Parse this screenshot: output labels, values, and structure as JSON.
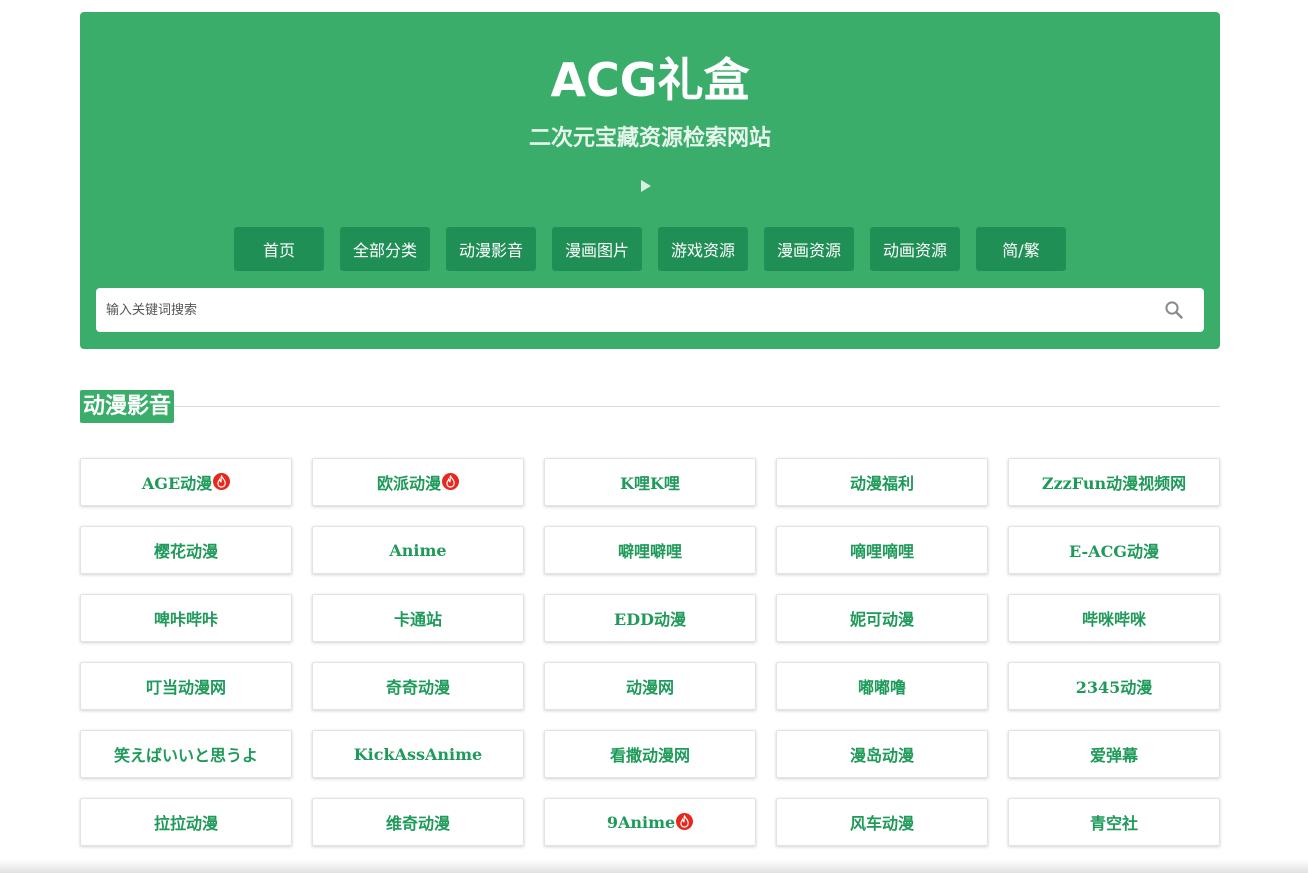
{
  "site": {
    "title": "ACG礼盒",
    "subtitle": "二次元宝藏资源检索网站"
  },
  "nav": [
    {
      "label": "首页",
      "name": "nav-home"
    },
    {
      "label": "全部分类",
      "name": "nav-all-categories"
    },
    {
      "label": "动漫影音",
      "name": "nav-anime-video"
    },
    {
      "label": "漫画图片",
      "name": "nav-manga-images"
    },
    {
      "label": "游戏资源",
      "name": "nav-game-resources"
    },
    {
      "label": "漫画资源",
      "name": "nav-manga-resources"
    },
    {
      "label": "动画资源",
      "name": "nav-animation-resources"
    },
    {
      "label": "简/繁",
      "name": "nav-simplified-traditional"
    }
  ],
  "search": {
    "placeholder": "输入关键词搜索",
    "value": ""
  },
  "section": {
    "title": "动漫影音"
  },
  "sites": [
    {
      "label": "AGE动漫",
      "hot": true
    },
    {
      "label": "欧派动漫",
      "hot": true
    },
    {
      "label": "K哩K哩",
      "hot": false
    },
    {
      "label": "动漫福利",
      "hot": false
    },
    {
      "label": "ZzzFun动漫视频网",
      "hot": false
    },
    {
      "label": "樱花动漫",
      "hot": false
    },
    {
      "label": "Anime",
      "hot": false
    },
    {
      "label": "噼哩噼哩",
      "hot": false
    },
    {
      "label": "嘀哩嘀哩",
      "hot": false
    },
    {
      "label": "E-ACG动漫",
      "hot": false
    },
    {
      "label": "啤咔哔咔",
      "hot": false
    },
    {
      "label": "卡通站",
      "hot": false
    },
    {
      "label": "EDD动漫",
      "hot": false
    },
    {
      "label": "妮可动漫",
      "hot": false
    },
    {
      "label": "哔咪哔咪",
      "hot": false
    },
    {
      "label": "叮当动漫网",
      "hot": false
    },
    {
      "label": "奇奇动漫",
      "hot": false
    },
    {
      "label": "动漫网",
      "hot": false
    },
    {
      "label": "嘟嘟噜",
      "hot": false
    },
    {
      "label": "2345动漫",
      "hot": false
    },
    {
      "label": "笑えばいいと思うよ",
      "hot": false
    },
    {
      "label": "KickAssAnime",
      "hot": false
    },
    {
      "label": "看撒动漫网",
      "hot": false
    },
    {
      "label": "漫岛动漫",
      "hot": false
    },
    {
      "label": "爱弹幕",
      "hot": false
    },
    {
      "label": "拉拉动漫",
      "hot": false
    },
    {
      "label": "维奇动漫",
      "hot": false
    },
    {
      "label": "9Anime",
      "hot": true
    },
    {
      "label": "风车动漫",
      "hot": false
    },
    {
      "label": "青空社",
      "hot": false
    }
  ],
  "colors": {
    "brand_green": "#3aad6b",
    "button_green": "#1f8f55",
    "link_green": "#1f9a5a",
    "hot_red": "#e8281d"
  },
  "icons": {
    "search": "search-icon",
    "play": "play-icon",
    "hot": "fire-icon"
  }
}
